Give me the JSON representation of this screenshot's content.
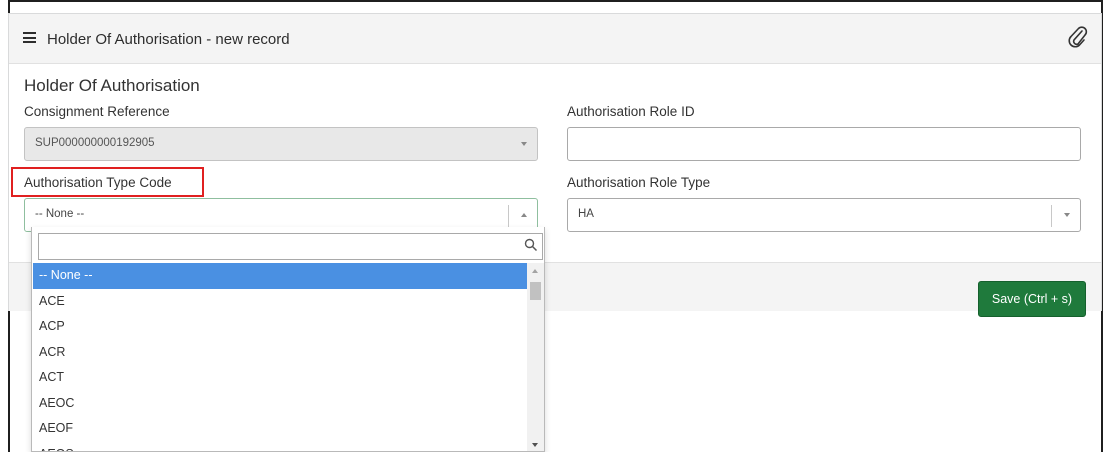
{
  "header": {
    "title": "Holder Of Authorisation - new record"
  },
  "section": {
    "title": "Holder Of Authorisation"
  },
  "form": {
    "consignment_reference": {
      "label": "Consignment Reference",
      "value": "SUP000000000192905"
    },
    "authorisation_role_id": {
      "label": "Authorisation Role ID",
      "value": ""
    },
    "authorisation_type_code": {
      "label": "Authorisation Type Code",
      "value": "-- None --"
    },
    "authorisation_role_type": {
      "label": "Authorisation Role Type",
      "value": "HA"
    }
  },
  "save_button": {
    "label": "Save (Ctrl + s)"
  },
  "dropdown": {
    "search_value": "",
    "options": [
      "-- None --",
      "ACE",
      "ACP",
      "ACR",
      "ACT",
      "AEOC",
      "AEOF",
      "AEOS"
    ],
    "selected_index": 0
  },
  "colors": {
    "accent_selected": "#4a90e2",
    "save_green": "#1f7a3c",
    "highlight_red": "#e02020"
  }
}
